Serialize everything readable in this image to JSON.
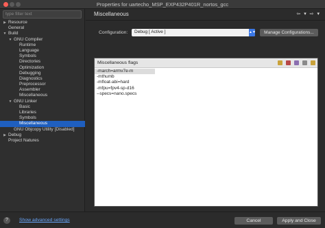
{
  "window": {
    "title": "Properties for uartecho_MSP_EXP432P401R_nortos_gcc"
  },
  "filter": {
    "placeholder": "type filter text"
  },
  "tree": [
    {
      "label": "Resource",
      "level": 0,
      "arrow": "▶"
    },
    {
      "label": "General",
      "level": 0,
      "arrow": ""
    },
    {
      "label": "Build",
      "level": 0,
      "arrow": "▼"
    },
    {
      "label": "GNU Compiler",
      "level": 1,
      "arrow": "▼"
    },
    {
      "label": "Runtime",
      "level": 2,
      "arrow": ""
    },
    {
      "label": "Language",
      "level": 2,
      "arrow": ""
    },
    {
      "label": "Symbols",
      "level": 2,
      "arrow": ""
    },
    {
      "label": "Directories",
      "level": 2,
      "arrow": ""
    },
    {
      "label": "Optimization",
      "level": 2,
      "arrow": ""
    },
    {
      "label": "Debugging",
      "level": 2,
      "arrow": ""
    },
    {
      "label": "Diagnostics",
      "level": 2,
      "arrow": ""
    },
    {
      "label": "Preprocessor",
      "level": 2,
      "arrow": ""
    },
    {
      "label": "Assembler",
      "level": 2,
      "arrow": ""
    },
    {
      "label": "Miscellaneous",
      "level": 2,
      "arrow": ""
    },
    {
      "label": "GNU Linker",
      "level": 1,
      "arrow": "▼"
    },
    {
      "label": "Basic",
      "level": 2,
      "arrow": ""
    },
    {
      "label": "Libraries",
      "level": 2,
      "arrow": ""
    },
    {
      "label": "Symbols",
      "level": 2,
      "arrow": ""
    },
    {
      "label": "Miscellaneous",
      "level": 2,
      "arrow": "",
      "selected": true
    },
    {
      "label": "GNU Objcopy Utility  [Disabled]",
      "level": 1,
      "arrow": ""
    },
    {
      "label": "Debug",
      "level": 0,
      "arrow": "▶"
    },
    {
      "label": "Project Natures",
      "level": 0,
      "arrow": ""
    }
  ],
  "page": {
    "title": "Miscellaneous"
  },
  "configuration": {
    "label": "Configuration:",
    "value": "Debug  [ Active ]",
    "manage_label": "Manage Configurations..."
  },
  "flags": {
    "title": "Miscellaneous flags",
    "items": [
      "-march=armv7e-m",
      "-mthumb",
      "-mfloat-abi=hard",
      "-mfpu=fpv4-sp-d16",
      "--specs=nano.specs"
    ]
  },
  "footer": {
    "help": "?",
    "advanced_link": "Show advanced settings",
    "cancel_label": "Cancel",
    "apply_label": "Apply and Close"
  }
}
